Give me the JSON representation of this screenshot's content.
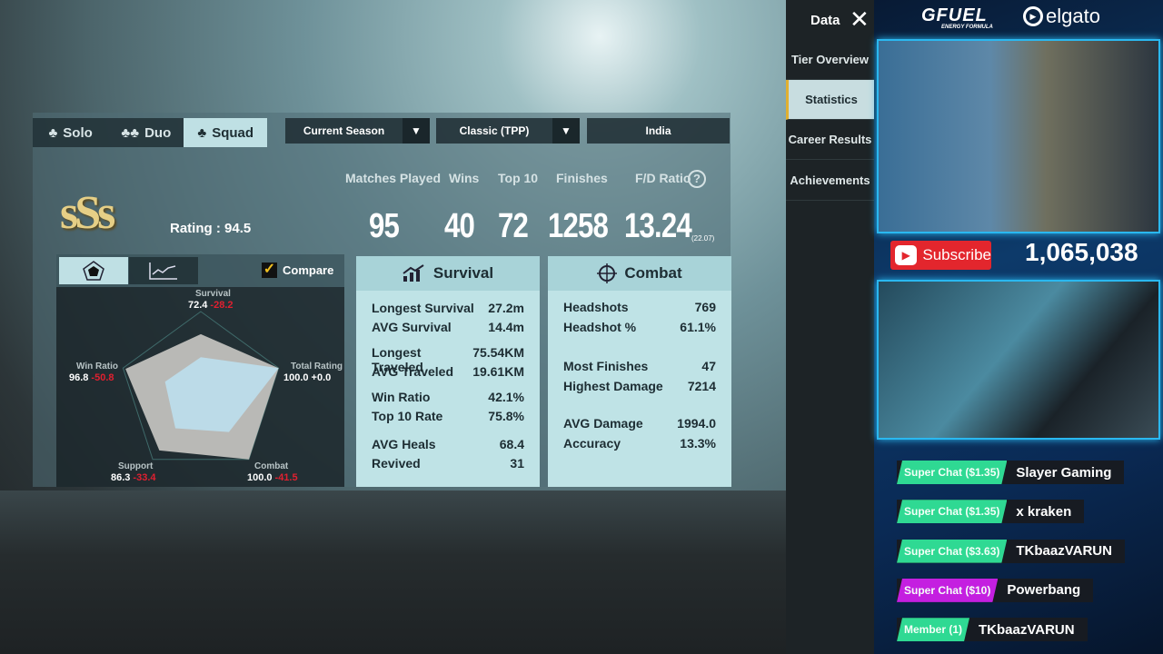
{
  "mode_tabs": [
    {
      "label": "Solo"
    },
    {
      "label": "Duo"
    },
    {
      "label": "Squad",
      "active": true
    }
  ],
  "filters": {
    "season": "Current Season",
    "mode": "Classic (TPP)",
    "region": "India"
  },
  "tier": {
    "logo_text": "sSs",
    "rating_label": "Rating",
    "rating_value": "94.5"
  },
  "summary": {
    "headers": [
      "Matches Played",
      "Wins",
      "Top 10",
      "Finishes",
      "F/D Ratio"
    ],
    "values": [
      "95",
      "40",
      "72",
      "1258",
      "13.24"
    ],
    "fd_sub": "(22.07)"
  },
  "chart_tabs": {
    "radar_icon": "pentagon-icon",
    "trend_icon": "line-chart-icon",
    "compare_label": "Compare",
    "compare_checked": true
  },
  "radar": {
    "axes": [
      {
        "label": "Survival",
        "value": 72.4,
        "delta": "-28.2"
      },
      {
        "label": "Total Rating",
        "value": 100.0,
        "delta": "+0.0"
      },
      {
        "label": "Combat",
        "value": 100.0,
        "delta": "-41.5"
      },
      {
        "label": "Support",
        "value": 86.3,
        "delta": "-33.4"
      },
      {
        "label": "Win Ratio",
        "value": 96.8,
        "delta": "-50.8"
      }
    ],
    "max": 100,
    "colors": {
      "player": "#b9b9b6",
      "compare": "#bcdbe8",
      "negative": "#e02030"
    }
  },
  "survival": {
    "title": "Survival",
    "rows": [
      [
        "Longest Survival",
        "27.2m"
      ],
      [
        "AVG Survival",
        "14.4m"
      ],
      [
        "Longest Traveled",
        "75.54KM"
      ],
      [
        "AVG Traveled",
        "19.61KM"
      ],
      [
        "Win Ratio",
        "42.1%"
      ],
      [
        "Top 10 Rate",
        "75.8%"
      ],
      [
        "AVG Heals",
        "68.4"
      ],
      [
        "Revived",
        "31"
      ]
    ]
  },
  "combat": {
    "title": "Combat",
    "rows": [
      [
        "Headshots",
        "769"
      ],
      [
        "Headshot %",
        "61.1%"
      ],
      [
        "Most Finishes",
        "47"
      ],
      [
        "Highest Damage",
        "7214"
      ],
      [
        "AVG Damage",
        "1994.0"
      ],
      [
        "Accuracy",
        "13.3%"
      ]
    ]
  },
  "sidebar": {
    "title": "Data",
    "items": [
      {
        "label": "Tier Overview"
      },
      {
        "label": "Statistics",
        "active": true
      },
      {
        "label": "Career Results"
      },
      {
        "label": "Achievements"
      }
    ]
  },
  "stream": {
    "sponsor1": "GFUEL",
    "sponsor1_sub": "ENERGY FORMULA",
    "sponsor2": "elgato",
    "subscribe": "Subscribe",
    "sub_count": "1,065,038",
    "alerts": [
      {
        "badge": "Super Chat ($1.35)",
        "name": "Slayer Gaming",
        "color": "#2fd993"
      },
      {
        "badge": "Super Chat ($1.35)",
        "name": "x kraken",
        "color": "#2fd993"
      },
      {
        "badge": "Super Chat ($3.63)",
        "name": "TKbaazVARUN",
        "color": "#2fd993"
      },
      {
        "badge": "Super Chat ($10)",
        "name": "Powerbang",
        "color": "#c41fe0"
      },
      {
        "badge": "Member (1)",
        "name": "TKbaazVARUN",
        "color": "#2fd993"
      }
    ]
  }
}
